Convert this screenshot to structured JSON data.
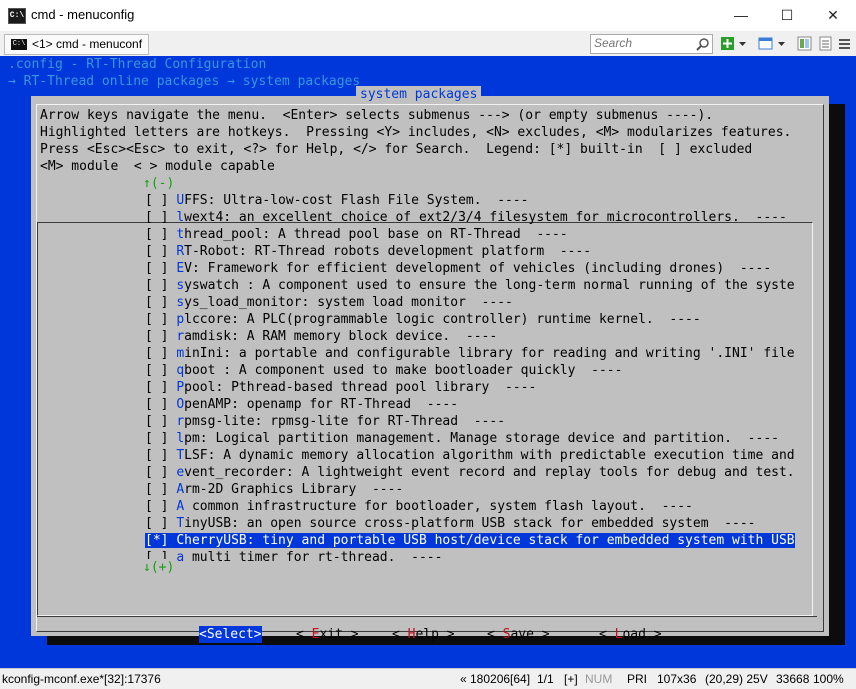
{
  "window": {
    "title": "cmd - menuconfig",
    "minimize_glyph": "—",
    "maximize_glyph": "☐",
    "close_glyph": "✕"
  },
  "toolbar": {
    "tab_label": "<1> cmd - menuconf",
    "search_placeholder": "Search"
  },
  "terminal": {
    "header_lines": [
      ".config - RT-Thread Configuration",
      "→ RT-Thread online packages → system packages"
    ],
    "dialog_title": "system packages",
    "help_lines": [
      "Arrow keys navigate the menu.  <Enter> selects submenus ---> (or empty submenus ----).",
      "Highlighted letters are hotkeys.  Pressing <Y> includes, <N> excludes, <M> modularizes features.",
      "Press <Esc><Esc> to exit, <?> for Help, </> for Search.  Legend: [*] built-in  [ ] excluded",
      "<M> module  < > module capable"
    ],
    "scroll_up": "↑(-)",
    "scroll_down": "↓(+)",
    "menu_items": [
      {
        "check": "[ ]",
        "hotkey": "U",
        "rest": "FFS: Ultra-low-cost Flash File System.  ----"
      },
      {
        "check": "[ ]",
        "hotkey": "l",
        "rest": "wext4: an excellent choice of ext2/3/4 filesystem for microcontrollers.  ----"
      },
      {
        "check": "[ ]",
        "hotkey": "t",
        "rest": "hread_pool: A thread pool base on RT-Thread  ----"
      },
      {
        "check": "[ ]",
        "hotkey": "R",
        "rest": "T-Robot: RT-Thread robots development platform  ----"
      },
      {
        "check": "[ ]",
        "hotkey": "E",
        "rest": "V: Framework for efficient development of vehicles (including drones)  ----"
      },
      {
        "check": "[ ]",
        "hotkey": "s",
        "rest": "yswatch : A component used to ensure the long-term normal running of the syste"
      },
      {
        "check": "[ ]",
        "hotkey": "s",
        "rest": "ys_load_monitor: system load monitor  ----"
      },
      {
        "check": "[ ]",
        "hotkey": "p",
        "rest": "lccore: A PLC(programmable logic controller) runtime kernel.  ----"
      },
      {
        "check": "[ ]",
        "hotkey": "r",
        "rest": "amdisk: A RAM memory block device.  ----"
      },
      {
        "check": "[ ]",
        "hotkey": "m",
        "rest": "inIni: a portable and configurable library for reading and writing '.INI' file"
      },
      {
        "check": "[ ]",
        "hotkey": "q",
        "rest": "boot : A component used to make bootloader quickly  ----"
      },
      {
        "check": "[ ]",
        "hotkey": "P",
        "rest": "pool: Pthread-based thread pool library  ----"
      },
      {
        "check": "[ ]",
        "hotkey": "O",
        "rest": "penAMP: openamp for RT-Thread  ----"
      },
      {
        "check": "[ ]",
        "hotkey": "r",
        "rest": "pmsg-lite: rpmsg-lite for RT-Thread  ----"
      },
      {
        "check": "[ ]",
        "hotkey": "l",
        "rest": "pm: Logical partition management. Manage storage device and partition.  ----"
      },
      {
        "check": "[ ]",
        "hotkey": "T",
        "rest": "LSF: A dynamic memory allocation algorithm with predictable execution time and"
      },
      {
        "check": "[ ]",
        "hotkey": "e",
        "rest": "vent_recorder: A lightweight event record and replay tools for debug and test."
      },
      {
        "check": "[ ]",
        "hotkey": "A",
        "rest": "rm-2D Graphics Library  ----"
      },
      {
        "check": "[ ]",
        "hotkey": "A",
        "rest": " common infrastructure for bootloader, system flash layout.  ----"
      },
      {
        "check": "[ ]",
        "hotkey": "T",
        "rest": "inyUSB: an open source cross-platform USB stack for embedded system  ----"
      },
      {
        "check": "[*]",
        "hotkey": "C",
        "rest": "herryUSB: tiny and portable USB host/device stack for embedded system with USB"
      },
      {
        "check": "[ ]",
        "hotkey": "a",
        "rest": " multi timer for rt-thread.  ----"
      }
    ],
    "buttons": [
      {
        "pre": "<",
        "hotkey": "S",
        "post": "elect>"
      },
      {
        "pre": "< ",
        "hotkey": "E",
        "post": "xit >"
      },
      {
        "pre": "< ",
        "hotkey": "H",
        "post": "elp >"
      },
      {
        "pre": "< ",
        "hotkey": "S",
        "post": "ave >"
      },
      {
        "pre": "< ",
        "hotkey": "L",
        "post": "oad >"
      }
    ]
  },
  "statusbar": {
    "process": "kconfig-mconf.exe*[32]:17376",
    "pos": "« 180206[64]",
    "page": "1/1",
    "ins": "[+]",
    "num": "NUM",
    "pri": "PRI",
    "size": "107x36",
    "cursor": "(20,29) 25V",
    "pid": "33668",
    "zoom": "100%"
  },
  "colors": {
    "terminal_bg": "#0037da",
    "dialog_bg": "#c0c0c0",
    "hotkey": "#0037da",
    "button_hotkey": "#c50f1f",
    "scroll_indicator": "#13a10e"
  }
}
